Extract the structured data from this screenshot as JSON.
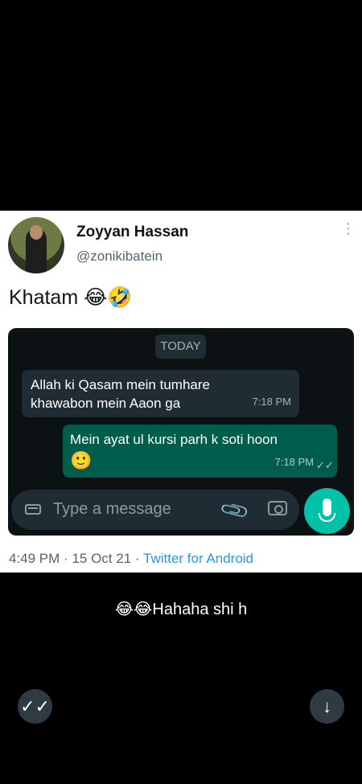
{
  "tweet": {
    "name": "Zoyyan Hassan",
    "handle": "@zonikibatein",
    "text": "Khatam",
    "emojis": "😂🤣",
    "time": "4:49 PM",
    "dot1": "·",
    "date": "15 Oct 21",
    "dot2": "·",
    "source": "Twitter for Android"
  },
  "chat": {
    "date_label": "TODAY",
    "incoming_text": "Allah ki Qasam mein tumhare\nkhawabon mein Aaon ga",
    "incoming_time": "7:18 PM",
    "outgoing_text": "Mein ayat ul kursi parh k soti hoon",
    "outgoing_emoji": "🙂",
    "outgoing_time": "7:18 PM",
    "read_check": "✓✓",
    "placeholder": "Type a message"
  },
  "caption": "😂😂Hahaha shi h",
  "icons": {
    "more": "more-vertical-icon",
    "attach": "paperclip-icon",
    "camera": "camera-icon",
    "mic": "mic-icon",
    "check": "double-check-icon",
    "down": "arrow-down-icon"
  }
}
